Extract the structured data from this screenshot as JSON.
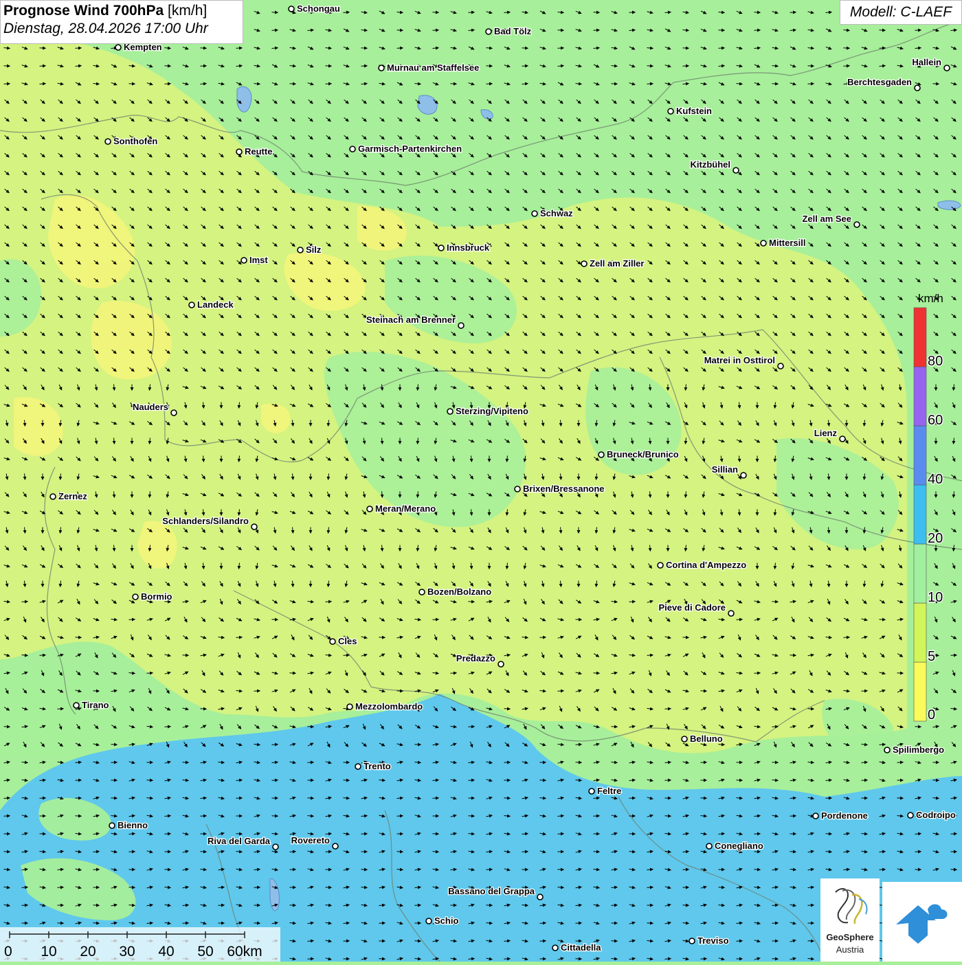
{
  "header": {
    "title_bold": "Prognose Wind 700hPa",
    "title_unit": "[km/h]",
    "datetime": "Dienstag, 28.04.2026 17:00 Uhr"
  },
  "model_label": "Modell: C-LAEF",
  "legend": {
    "unit": "km/h",
    "classes": [
      {
        "label": "0",
        "color": "#fafa5a"
      },
      {
        "label": "5",
        "color": "#d2f55a"
      },
      {
        "label": "10",
        "color": "#a0f0a0"
      },
      {
        "label": "20",
        "color": "#3cbef0"
      },
      {
        "label": "40",
        "color": "#5a8cf0"
      },
      {
        "label": "60",
        "color": "#9664f0"
      },
      {
        "label": "80",
        "color": "#f03232"
      }
    ]
  },
  "scale_bar": {
    "labels": [
      "0",
      "10",
      "20",
      "30",
      "40",
      "50",
      "60km"
    ]
  },
  "cities": [
    {
      "name": "Schongau"
    },
    {
      "name": "Bad Tölz"
    },
    {
      "name": "Kempten"
    },
    {
      "name": "Murnau am Staffelsee"
    },
    {
      "name": "Hallein"
    },
    {
      "name": "Berchtesgaden"
    },
    {
      "name": "Kufstein"
    },
    {
      "name": "Sonthofen"
    },
    {
      "name": "Reutte"
    },
    {
      "name": "Garmisch-Partenkirchen"
    },
    {
      "name": "Kitzbühel"
    },
    {
      "name": "Schwaz"
    },
    {
      "name": "Zell am See"
    },
    {
      "name": "Mittersill"
    },
    {
      "name": "Silz"
    },
    {
      "name": "Innsbruck"
    },
    {
      "name": "Imst"
    },
    {
      "name": "Zell am Ziller"
    },
    {
      "name": "Landeck"
    },
    {
      "name": "Steinach am Brenner"
    },
    {
      "name": "Matrei in Osttirol"
    },
    {
      "name": "Nauders"
    },
    {
      "name": "Sterzing/Vipiteno"
    },
    {
      "name": "Lienz"
    },
    {
      "name": "Bruneck/Brunico"
    },
    {
      "name": "Sillian"
    },
    {
      "name": "Brixen/Bressanone"
    },
    {
      "name": "Zernez"
    },
    {
      "name": "Meran/Merano"
    },
    {
      "name": "Schlanders/Silandro"
    },
    {
      "name": "Cortina d'Ampezzo"
    },
    {
      "name": "Bozen/Bolzano"
    },
    {
      "name": "Bormio"
    },
    {
      "name": "Pieve di Cadore"
    },
    {
      "name": "Cles"
    },
    {
      "name": "Predazzo"
    },
    {
      "name": "Tirano"
    },
    {
      "name": "Mezzolombardo"
    },
    {
      "name": "Belluno"
    },
    {
      "name": "Spilimbergo"
    },
    {
      "name": "Trento"
    },
    {
      "name": "Feltre"
    },
    {
      "name": "Pordenone"
    },
    {
      "name": "Codroipo"
    },
    {
      "name": "Bienno"
    },
    {
      "name": "Riva del Garda"
    },
    {
      "name": "Rovereto"
    },
    {
      "name": "Conegliano"
    },
    {
      "name": "Bassano del Grappa"
    },
    {
      "name": "Schio"
    },
    {
      "name": "Treviso"
    },
    {
      "name": "Cittadella"
    }
  ],
  "logos": {
    "geosphere_line1": "GeoSphere",
    "geosphere_line2": "Austria"
  }
}
